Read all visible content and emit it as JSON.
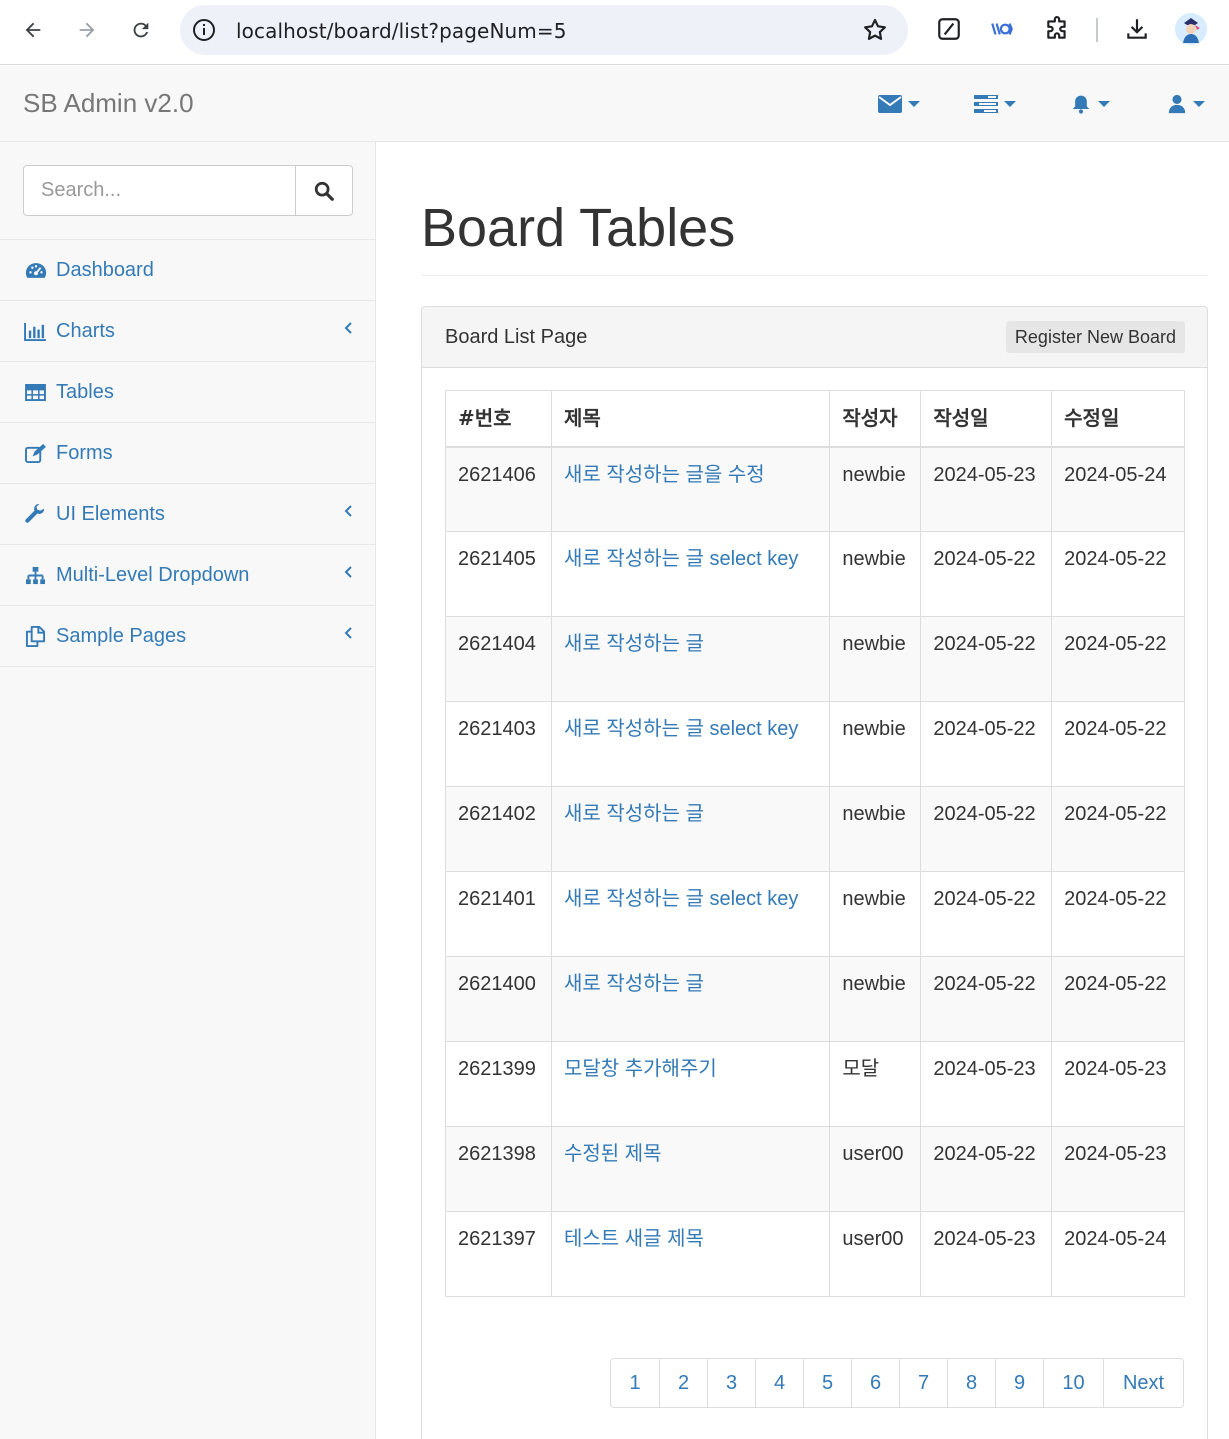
{
  "browser": {
    "url": "localhost/board/list?pageNum=5"
  },
  "navbar": {
    "brand": "SB Admin v2.0",
    "icons": [
      "envelope-icon",
      "tasks-icon",
      "bell-icon",
      "user-icon"
    ]
  },
  "sidebar": {
    "search_placeholder": "Search...",
    "items": [
      {
        "label": "Dashboard",
        "icon": "dashboard-icon",
        "has_arrow": false
      },
      {
        "label": "Charts",
        "icon": "bar-chart-icon",
        "has_arrow": true
      },
      {
        "label": "Tables",
        "icon": "table-icon",
        "has_arrow": false
      },
      {
        "label": "Forms",
        "icon": "edit-icon",
        "has_arrow": false
      },
      {
        "label": "UI Elements",
        "icon": "wrench-icon",
        "has_arrow": true
      },
      {
        "label": "Multi-Level Dropdown",
        "icon": "sitemap-icon",
        "has_arrow": true
      },
      {
        "label": "Sample Pages",
        "icon": "files-icon",
        "has_arrow": true
      }
    ]
  },
  "main": {
    "page_title": "Board Tables",
    "panel_title": "Board List Page",
    "register_button": "Register New Board",
    "table": {
      "headers": [
        "#번호",
        "제목",
        "작성자",
        "작성일",
        "수정일"
      ],
      "rows": [
        [
          "2621406",
          "새로 작성하는 글을 수정",
          "newbie",
          "2024-05-23",
          "2024-05-24"
        ],
        [
          "2621405",
          "새로 작성하는 글 select key",
          "newbie",
          "2024-05-22",
          "2024-05-22"
        ],
        [
          "2621404",
          "새로 작성하는 글",
          "newbie",
          "2024-05-22",
          "2024-05-22"
        ],
        [
          "2621403",
          "새로 작성하는 글 select key",
          "newbie",
          "2024-05-22",
          "2024-05-22"
        ],
        [
          "2621402",
          "새로 작성하는 글",
          "newbie",
          "2024-05-22",
          "2024-05-22"
        ],
        [
          "2621401",
          "새로 작성하는 글 select key",
          "newbie",
          "2024-05-22",
          "2024-05-22"
        ],
        [
          "2621400",
          "새로 작성하는 글",
          "newbie",
          "2024-05-22",
          "2024-05-22"
        ],
        [
          "2621399",
          "모달창 추가해주기",
          "모달",
          "2024-05-23",
          "2024-05-23"
        ],
        [
          "2621398",
          "수정된 제목",
          "user00",
          "2024-05-22",
          "2024-05-23"
        ],
        [
          "2621397",
          "테스트 새글 제목",
          "user00",
          "2024-05-23",
          "2024-05-24"
        ]
      ]
    },
    "pagination": [
      "1",
      "2",
      "3",
      "4",
      "5",
      "6",
      "7",
      "8",
      "9",
      "10",
      "Next"
    ]
  },
  "colors": {
    "link": "#337ab7",
    "stripe": "#f9f9f9",
    "sidebar_bg": "#f8f8f8"
  }
}
